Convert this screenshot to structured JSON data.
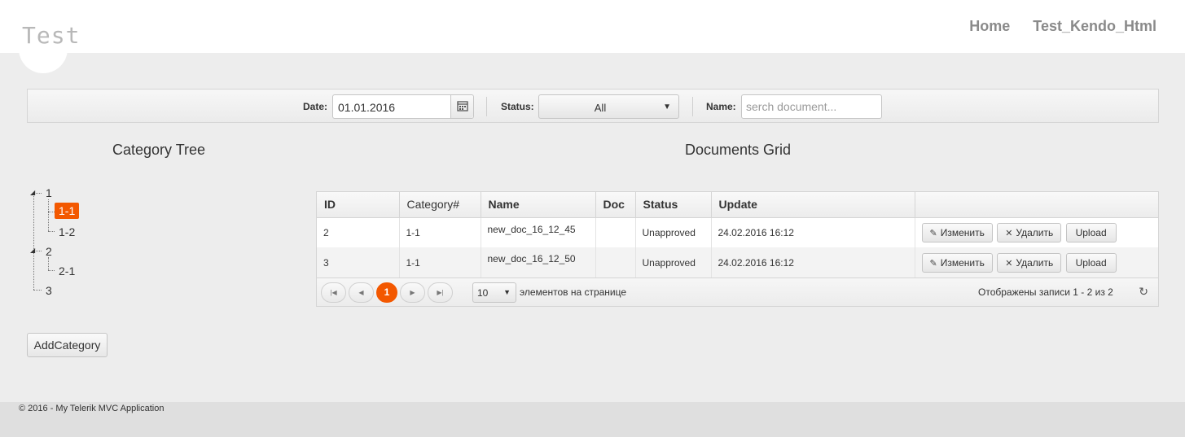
{
  "header": {
    "logo": "Test",
    "nav": [
      {
        "label": "Home"
      },
      {
        "label": "Test_Kendo_Html"
      }
    ]
  },
  "toolbar": {
    "date_label": "Date:",
    "date_value": "01.01.2016",
    "status_label": "Status:",
    "status_value": "All",
    "name_label": "Name:",
    "name_placeholder": "serch document..."
  },
  "category_tree": {
    "title": "Category Tree",
    "nodes": [
      {
        "label": "1",
        "children": [
          {
            "label": "1-1",
            "selected": true
          },
          {
            "label": "1-2"
          }
        ]
      },
      {
        "label": "2",
        "children": [
          {
            "label": "2-1"
          }
        ]
      },
      {
        "label": "3"
      }
    ],
    "add_button": "AddCategory"
  },
  "grid": {
    "title": "Documents Grid",
    "columns": [
      "ID",
      "Category#",
      "Name",
      "Doc",
      "Status",
      "Update",
      ""
    ],
    "rows": [
      {
        "id": "2",
        "category": "1-1",
        "name": "new_doc_16_12_45",
        "doc": "",
        "status": "Unapproved",
        "update": "24.02.2016 16:12"
      },
      {
        "id": "3",
        "category": "1-1",
        "name": "new_doc_16_12_50",
        "doc": "",
        "status": "Unapproved",
        "update": "24.02.2016 16:12"
      }
    ],
    "actions": {
      "edit": "Изменить",
      "delete": "Удалить",
      "upload": "Upload"
    },
    "pager": {
      "current_page": "1",
      "page_size": "10",
      "page_size_label": "элементов на странице",
      "info": "Отображены записи 1 - 2 из 2"
    }
  },
  "footer": {
    "text": "© 2016 - My Telerik MVC Application"
  },
  "colors": {
    "accent": "#f35800",
    "background": "#ededed",
    "header": "#ffffff"
  }
}
